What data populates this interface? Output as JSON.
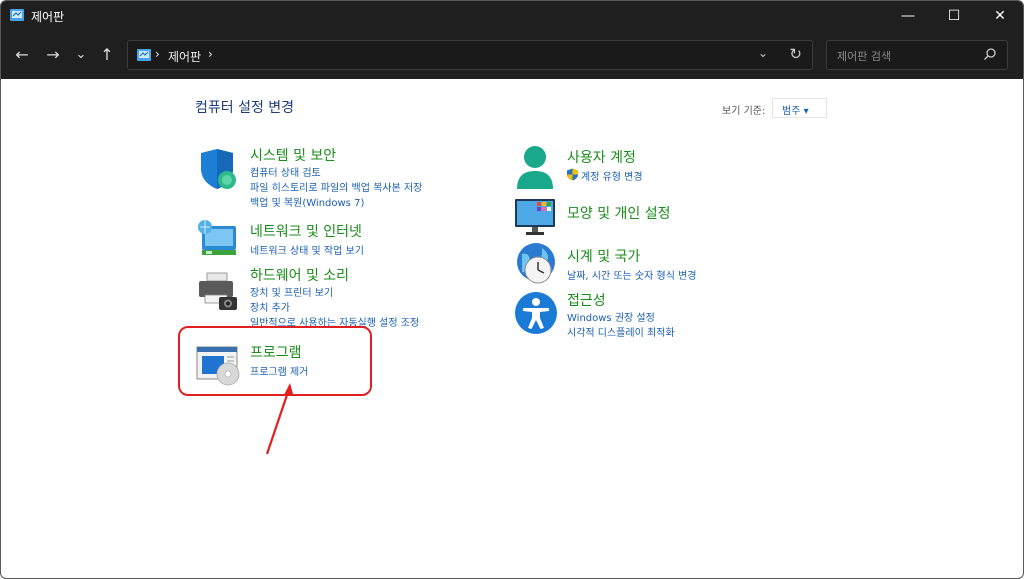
{
  "window": {
    "title": "제어판"
  },
  "window_controls": {
    "minimize": "—",
    "maximize": "☐",
    "close": "✕"
  },
  "nav": {
    "back": "←",
    "forward": "→",
    "recent": "⌄",
    "up": "↑"
  },
  "address": {
    "path": "제어판",
    "sep1": "›",
    "sep2": "›",
    "dropdown": "⌄",
    "refresh": "↻"
  },
  "search": {
    "placeholder": "제어판 검색"
  },
  "main": {
    "heading": "컴퓨터 설정 변경",
    "view_by_label": "보기 기준:",
    "view_by_value": "범주 ▾"
  },
  "categories": {
    "system_security": {
      "title": "시스템 및 보안",
      "links": [
        "컴퓨터 상태 검토",
        "파일 히스토리로 파일의 백업 복사본 저장",
        "백업 및 복원(Windows 7)"
      ]
    },
    "network": {
      "title": "네트워크 및 인터넷",
      "links": [
        "네트워크 상태 및 작업 보기"
      ]
    },
    "hardware": {
      "title": "하드웨어 및 소리",
      "links": [
        "장치 및 프린터 보기",
        "장치 추가",
        "일반적으로 사용하는 자동실행 설정 조정"
      ]
    },
    "programs": {
      "title": "프로그램",
      "links": [
        "프로그램 제거"
      ]
    },
    "user_accounts": {
      "title": "사용자 계정",
      "links": [
        "계정 유형 변경"
      ]
    },
    "appearance": {
      "title": "모양 및 개인 설정"
    },
    "clock": {
      "title": "시계 및 국가",
      "links": [
        "날짜, 시간 또는 숫자 형식 변경"
      ]
    },
    "ease": {
      "title": "접근성",
      "links": [
        "Windows 권장 설정",
        "시각적 디스플레이 최적화"
      ]
    }
  },
  "colors": {
    "title_green": "#1a8d1a",
    "link_blue": "#1a5fb4",
    "heading_navy": "#1e3b7a",
    "highlight_red": "#e02020",
    "chrome_dark": "#1f1f1f"
  }
}
